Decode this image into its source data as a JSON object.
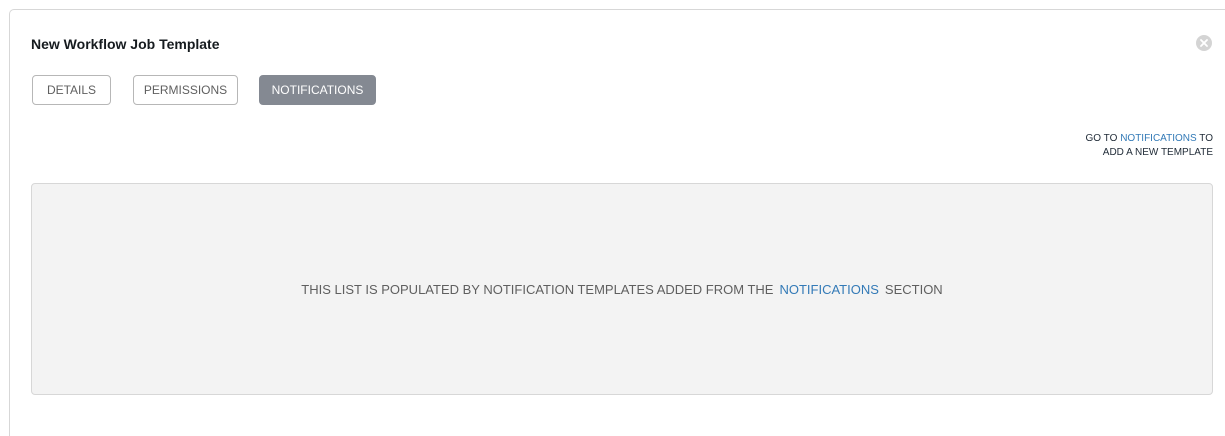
{
  "panel": {
    "title": "New Workflow Job Template",
    "close_icon": "times-circle-icon"
  },
  "tabs": [
    {
      "label": "DETAILS",
      "active": false
    },
    {
      "label": "PERMISSIONS",
      "active": false
    },
    {
      "label": "NOTIFICATIONS",
      "active": true
    }
  ],
  "goto_notice": {
    "prefix": "GO TO",
    "link": "NOTIFICATIONS",
    "suffix": "TO",
    "line2": "ADD A NEW TEMPLATE"
  },
  "empty_list": {
    "prefix": "THIS LIST IS POPULATED BY NOTIFICATION TEMPLATES ADDED FROM THE",
    "link": "NOTIFICATIONS",
    "suffix": "SECTION"
  },
  "colors": {
    "active_tab_bg": "#848992",
    "link": "#337ab7",
    "empty_bg": "#f3f3f3"
  }
}
